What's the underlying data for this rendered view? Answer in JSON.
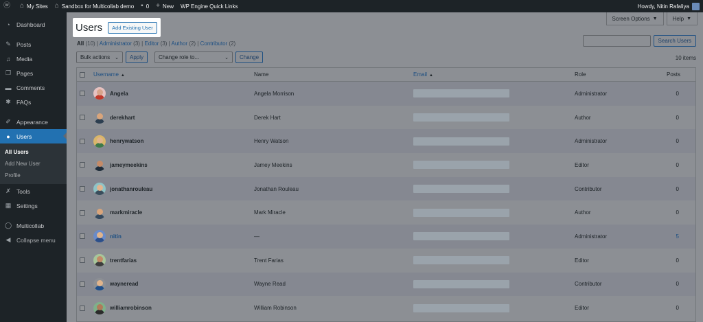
{
  "adminbar": {
    "my_sites": "My Sites",
    "site_name": "Sandbox for Multicollab demo",
    "comments_count": "0",
    "new_label": "New",
    "quick_links": "WP Engine Quick Links",
    "howdy": "Howdy, Nitin Rafaliya"
  },
  "sidebar": {
    "items": [
      {
        "label": "Dashboard",
        "icon": "dashboard-icon"
      },
      {
        "label": "Posts",
        "icon": "pin-icon"
      },
      {
        "label": "Media",
        "icon": "media-icon"
      },
      {
        "label": "Pages",
        "icon": "pages-icon"
      },
      {
        "label": "Comments",
        "icon": "comments-icon"
      },
      {
        "label": "FAQs",
        "icon": "faq-icon"
      },
      {
        "label": "Appearance",
        "icon": "brush-icon"
      },
      {
        "label": "Users",
        "icon": "user-icon"
      },
      {
        "label": "Tools",
        "icon": "wrench-icon"
      },
      {
        "label": "Settings",
        "icon": "settings-icon"
      },
      {
        "label": "Multicollab",
        "icon": "multicollab-icon"
      },
      {
        "label": "Collapse menu",
        "icon": "collapse-icon"
      }
    ],
    "submenu": [
      "All Users",
      "Add New User",
      "Profile"
    ]
  },
  "screen_meta": {
    "screen_options": "Screen Options",
    "help": "Help"
  },
  "page": {
    "title": "Users",
    "add_existing": "Add Existing User"
  },
  "filters": {
    "all": "All",
    "all_count": "(10)",
    "administrator": "Administrator",
    "administrator_count": "(3)",
    "editor": "Editor",
    "editor_count": "(3)",
    "author": "Author",
    "author_count": "(2)",
    "contributor": "Contributor",
    "contributor_count": "(2)"
  },
  "search": {
    "value": "",
    "button": "Search Users"
  },
  "tablenav": {
    "bulk_actions": "Bulk actions",
    "apply": "Apply",
    "change_role": "Change role to...",
    "change": "Change",
    "items_count": "10 items"
  },
  "table": {
    "headers": {
      "username": "Username",
      "name": "Name",
      "email": "Email",
      "role": "Role",
      "posts": "Posts"
    },
    "rows": [
      {
        "username": "Angela",
        "name": "Angela Morrison",
        "role": "Administrator",
        "posts": "0",
        "avatar": {
          "bg": "#e6c2c2",
          "skin": "#d8a58c",
          "shirt": "#c0392b"
        }
      },
      {
        "username": "derekhart",
        "name": "Derek Hart",
        "role": "Author",
        "posts": "0",
        "avatar": {
          "bg": "#8c8f94",
          "skin": "#d9a57b",
          "shirt": "#2c3e50"
        }
      },
      {
        "username": "henrywatson",
        "name": "Henry Watson",
        "role": "Administrator",
        "posts": "0",
        "avatar": {
          "bg": "#d9b66a",
          "skin": "#e0b48c",
          "shirt": "#3d7a4a"
        }
      },
      {
        "username": "jameymeekins",
        "name": "Jamey Meekins",
        "role": "Editor",
        "posts": "0",
        "avatar": {
          "bg": "#8c8f94",
          "skin": "#c48b68",
          "shirt": "#1f2d3a"
        }
      },
      {
        "username": "jonathanrouleau",
        "name": "Jonathan Rouleau",
        "role": "Contributor",
        "posts": "0",
        "avatar": {
          "bg": "#8fc4c6",
          "skin": "#e2b48e",
          "shirt": "#3a4d5c"
        }
      },
      {
        "username": "markmiracle",
        "name": "Mark Miracle",
        "role": "Author",
        "posts": "0",
        "avatar": {
          "bg": "#8c8f94",
          "skin": "#d9a57b",
          "shirt": "#34495e"
        }
      },
      {
        "username": "nitin",
        "name": "—",
        "role": "Administrator",
        "posts": "5",
        "avatar": {
          "bg": "#6a8bc8",
          "skin": "#e0b48c",
          "shirt": "#2c4f8a"
        }
      },
      {
        "username": "trentfarias",
        "name": "Trent Farias",
        "role": "Editor",
        "posts": "0",
        "avatar": {
          "bg": "#a8c69a",
          "skin": "#c48b68",
          "shirt": "#3d3d3d"
        }
      },
      {
        "username": "wayneread",
        "name": "Wayne Read",
        "role": "Contributor",
        "posts": "0",
        "avatar": {
          "bg": "#8c8f94",
          "skin": "#e0b48c",
          "shirt": "#1f4f8a"
        }
      },
      {
        "username": "williamrobinson",
        "name": "William Robinson",
        "role": "Editor",
        "posts": "0",
        "avatar": {
          "bg": "#7fb08a",
          "skin": "#b07a5a",
          "shirt": "#2b2b2b"
        }
      }
    ]
  }
}
